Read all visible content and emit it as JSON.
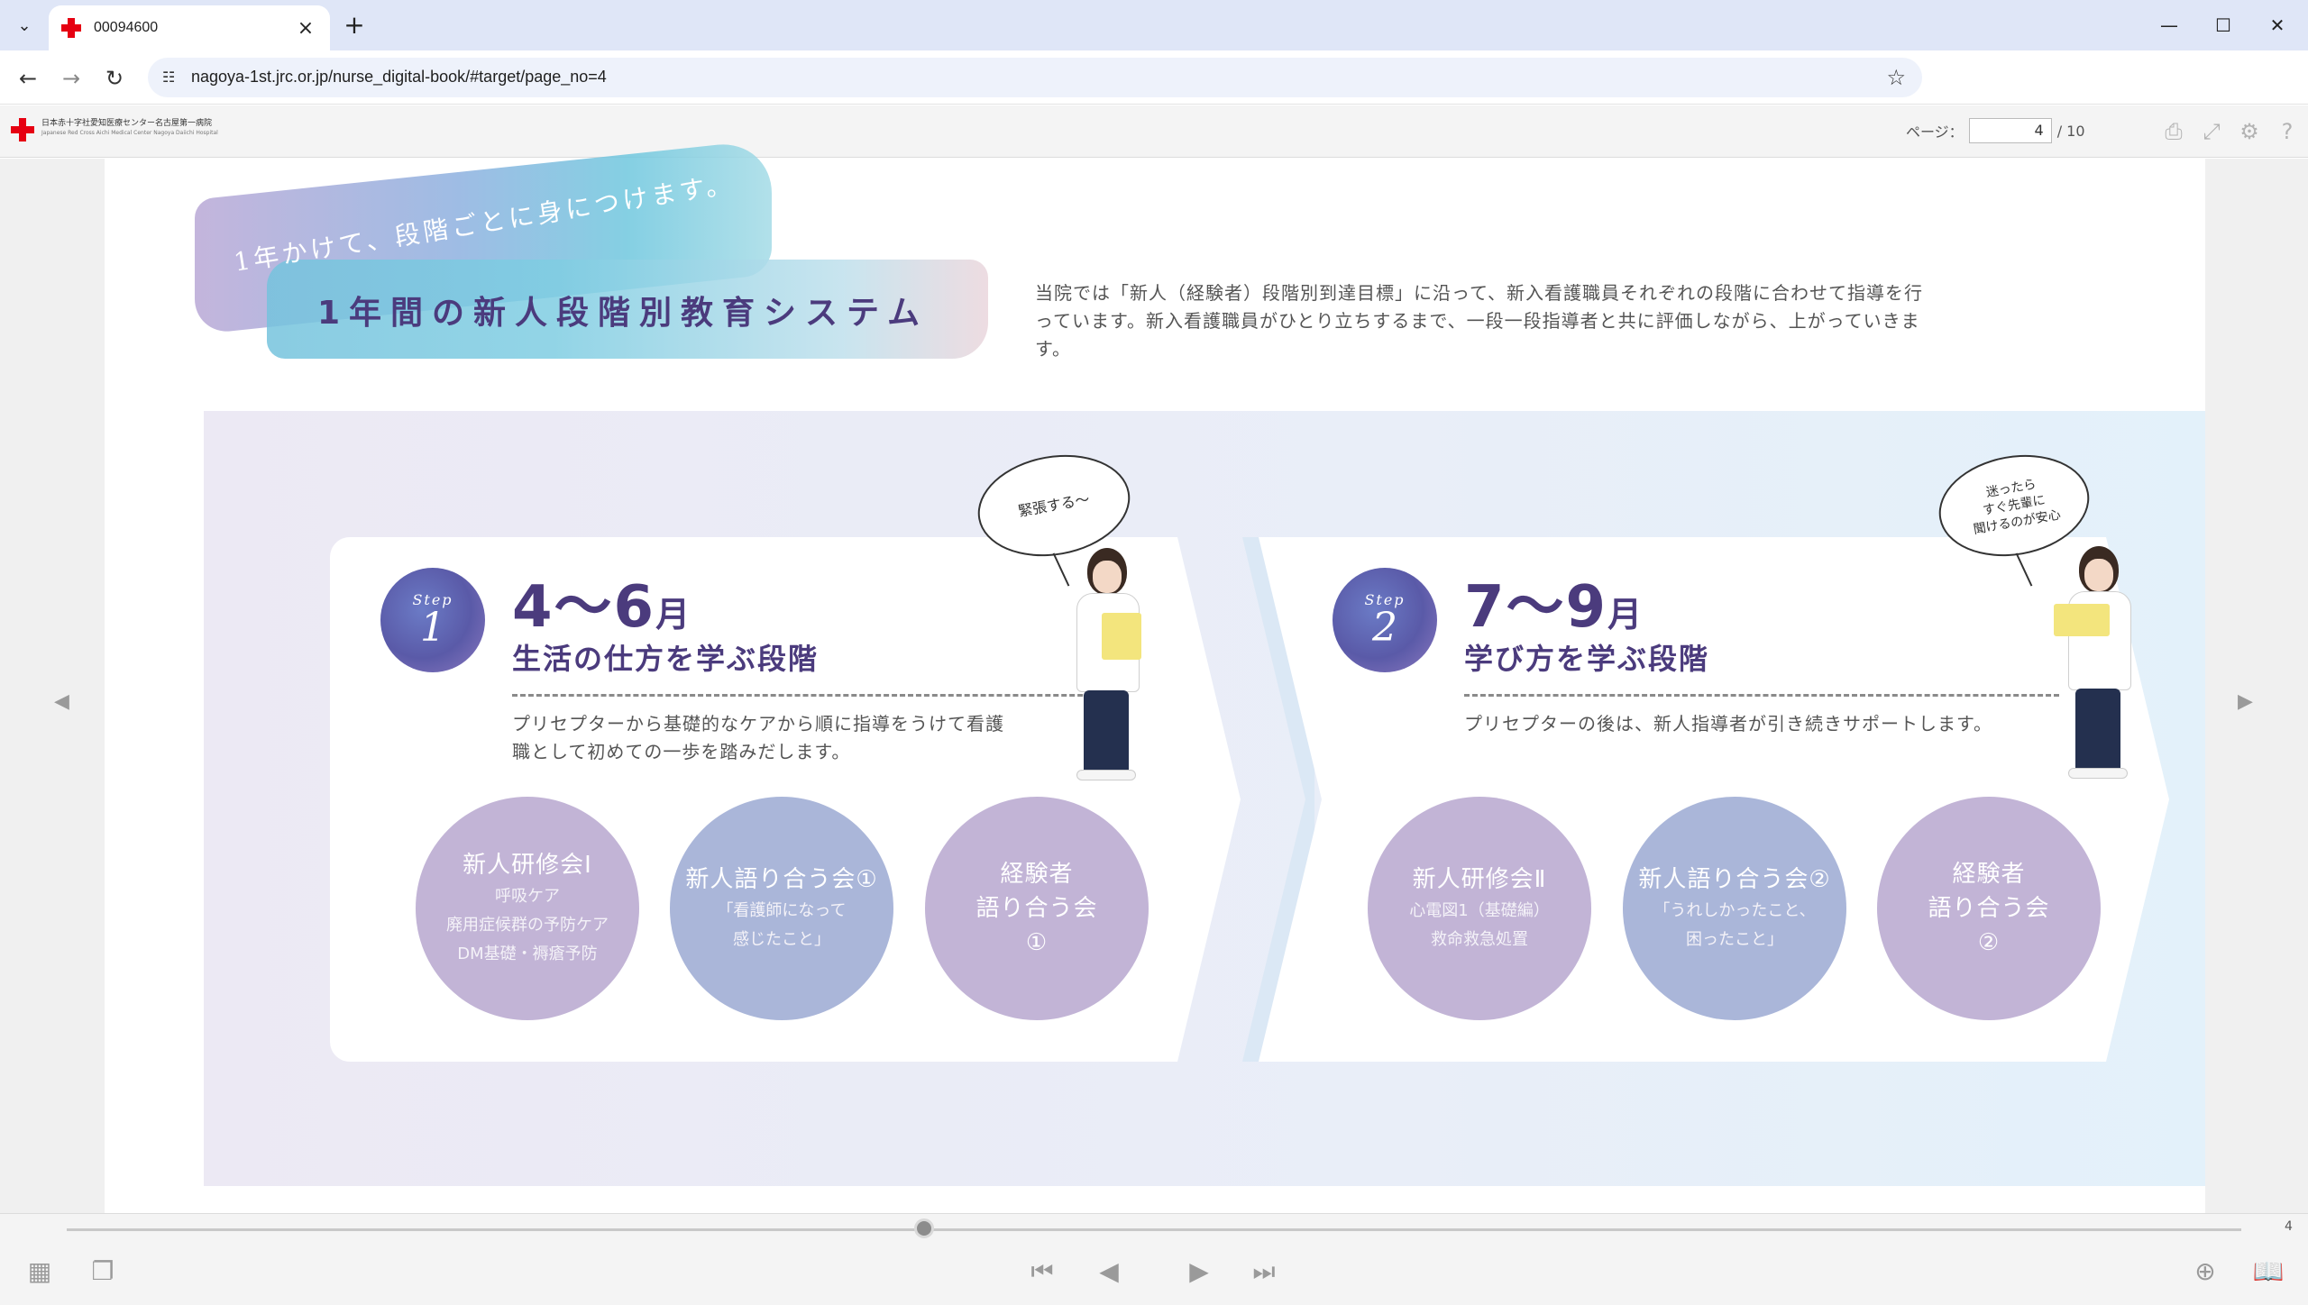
{
  "browser": {
    "tab_title": "00094600",
    "url": "nagoya-1st.jrc.or.jp/nurse_digital-book/#target/page_no=4"
  },
  "viewer": {
    "org_name": "日本赤十字社愛知医療センター名古屋第一病院",
    "org_name_en": "Japanese Red Cross Aichi Medical Center Nagoya Daiichi Hospital",
    "page_label": "ページ：",
    "page_current": "4",
    "page_total": "/ 10",
    "slider_value": "4"
  },
  "page": {
    "hero_script": "1年かけて、段階ごとに身につけます。",
    "hero_title": "1年間の新人段階別教育システム",
    "intro": "当院では「新人（経験者）段階別到達目標」に沿って、新入看護職員それぞれの段階に合わせて指導を行っています。新入看護職員がひとり立ちするまで、一段一段指導者と共に評価しながら、上がっていきます。",
    "steps": [
      {
        "badge_label": "Step",
        "badge_num": "1",
        "months": "4〜6",
        "month_unit": "月",
        "stage": "生活の仕方を学ぶ段階",
        "desc": "プリセプターから基礎的なケアから順に指導をうけて看護職として初めての一歩を踏みだします。",
        "bubble": "緊張する〜",
        "circles": [
          {
            "title": "新人研修会Ⅰ",
            "sub": [
              "呼吸ケア",
              "廃用症候群の予防ケア",
              "DM基礎・褥瘡予防"
            ]
          },
          {
            "title": "新人語り合う会①",
            "sub": [
              "「看護師になって",
              "感じたこと」"
            ]
          },
          {
            "title": "経験者\n語り合う会\n①",
            "sub": []
          }
        ]
      },
      {
        "badge_label": "Step",
        "badge_num": "2",
        "months": "7〜9",
        "month_unit": "月",
        "stage": "学び方を学ぶ段階",
        "desc": "プリセプターの後は、新人指導者が引き続きサポートします。",
        "bubble": "迷ったら\nすぐ先輩に\n聞けるのが安心",
        "circles": [
          {
            "title": "新人研修会Ⅱ",
            "sub": [
              "心電図1（基礎編）",
              "救命救急処置"
            ]
          },
          {
            "title": "新人語り合う会②",
            "sub": [
              "「うれしかったこと、",
              "困ったこと」"
            ]
          },
          {
            "title": "経験者\n語り合う会\n②",
            "sub": []
          }
        ]
      }
    ]
  },
  "colors": {
    "accent_purple": "#4b3b7d",
    "circle_purple": "#c2b4d6",
    "circle_blue": "#aab6d9",
    "brand_red": "#e60012"
  },
  "icons": {
    "print": "print-icon",
    "fullscreen": "fullscreen-icon",
    "settings": "gear-icon",
    "help": "help-icon",
    "thumbnails": "grid-icon",
    "pages": "pages-icon",
    "first": "first-page-icon",
    "prev": "prev-page-icon",
    "next": "next-page-icon",
    "last": "last-page-icon",
    "zoom": "zoom-in-icon",
    "book": "book-icon"
  }
}
